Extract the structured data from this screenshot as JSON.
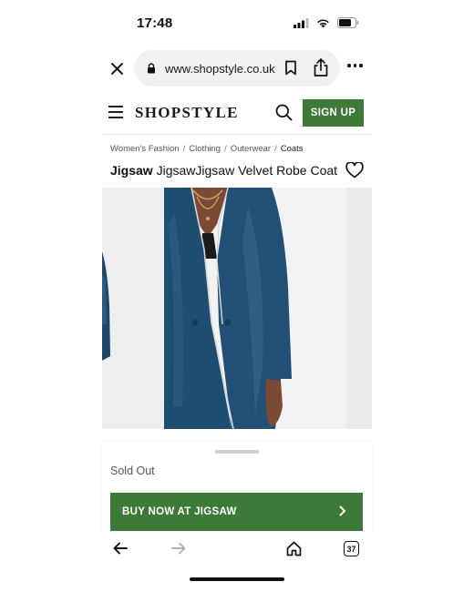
{
  "status_bar": {
    "time": "17:48",
    "icons": [
      "signal-icon",
      "wifi-icon",
      "battery-icon"
    ]
  },
  "browser": {
    "url": "www.shopstyle.co.uk",
    "tab_count": "37",
    "icons": {
      "close": "close-icon",
      "lock": "lock-icon",
      "bookmark": "bookmark-icon",
      "share": "share-icon",
      "more": "more-icon",
      "back": "arrow-left-icon",
      "forward": "arrow-right-icon",
      "home": "home-icon",
      "tabs": "tabs-icon"
    }
  },
  "header": {
    "logo": "SHOPSTYLE",
    "signup_label": "SIGN UP",
    "accent_color": "#3e7a37"
  },
  "breadcrumb": {
    "items": [
      "Women's Fashion",
      "Clothing",
      "Outerwear",
      "Coats"
    ],
    "separator": "/"
  },
  "product": {
    "brand": "Jigsaw",
    "title": "JigsawJigsaw Velvet Robe Coat",
    "image_colors": {
      "velvet": "#1f4a6e",
      "background": "#f0f0f0"
    }
  },
  "purchase": {
    "status": "Sold Out",
    "buy_label": "BUY NOW AT JIGSAW"
  }
}
